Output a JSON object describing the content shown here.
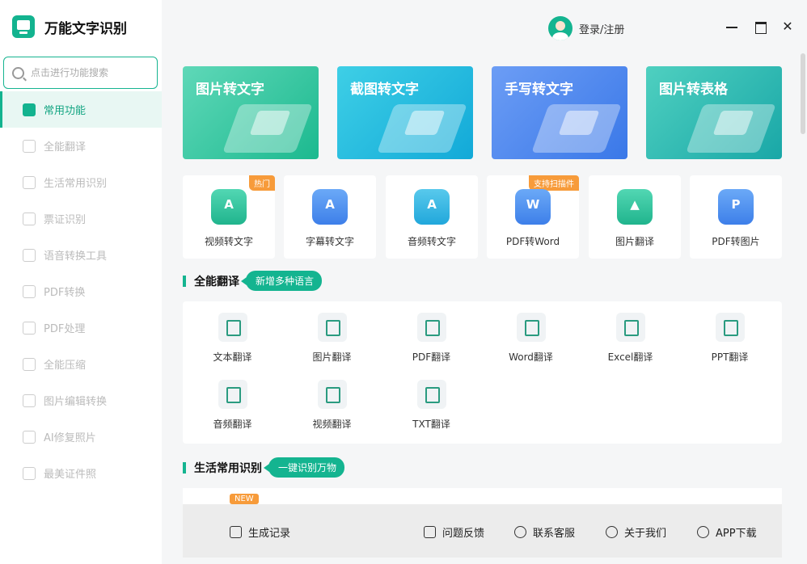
{
  "app": {
    "title": "万能文字识别"
  },
  "search": {
    "placeholder": "点击进行功能搜索"
  },
  "sidebar": {
    "items": [
      {
        "label": "常用功能",
        "active": true
      },
      {
        "label": "全能翻译"
      },
      {
        "label": "生活常用识别"
      },
      {
        "label": "票证识别"
      },
      {
        "label": "语音转换工具"
      },
      {
        "label": "PDF转换"
      },
      {
        "label": "PDF处理"
      },
      {
        "label": "全能压缩"
      },
      {
        "label": "图片编辑转换"
      },
      {
        "label": "AI修复照片"
      },
      {
        "label": "最美证件照"
      }
    ]
  },
  "header": {
    "login_label": "登录/注册",
    "close_glyph": "✕"
  },
  "big_cards": [
    {
      "label": "图片转文字"
    },
    {
      "label": "截图转文字"
    },
    {
      "label": "手写转文字"
    },
    {
      "label": "图片转表格"
    }
  ],
  "tools": [
    {
      "label": "视频转文字",
      "badge": "热门",
      "icon_char": "A"
    },
    {
      "label": "字幕转文字",
      "icon_char": "A"
    },
    {
      "label": "音频转文字",
      "icon_char": "A"
    },
    {
      "label": "PDF转Word",
      "badge": "支持扫描件",
      "icon_char": "W"
    },
    {
      "label": "图片翻译",
      "icon_char": "▲"
    },
    {
      "label": "PDF转图片",
      "icon_char": "P"
    }
  ],
  "translate_section": {
    "title": "全能翻译",
    "tag": "新增多种语言"
  },
  "translate_items": [
    {
      "label": "文本翻译"
    },
    {
      "label": "图片翻译"
    },
    {
      "label": "PDF翻译"
    },
    {
      "label": "Word翻译"
    },
    {
      "label": "Excel翻译"
    },
    {
      "label": "PPT翻译"
    },
    {
      "label": "音频翻译"
    },
    {
      "label": "视频翻译"
    },
    {
      "label": "TXT翻译"
    }
  ],
  "life_section": {
    "title": "生活常用识别",
    "tag": "一键识别万物",
    "new_badge": "NEW"
  },
  "footer": {
    "records": "生成记录",
    "feedback": "问题反馈",
    "service": "联系客服",
    "about": "关于我们",
    "app": "APP下载"
  },
  "colors": {
    "accent": "#14b490",
    "badge": "#f79b3a"
  }
}
